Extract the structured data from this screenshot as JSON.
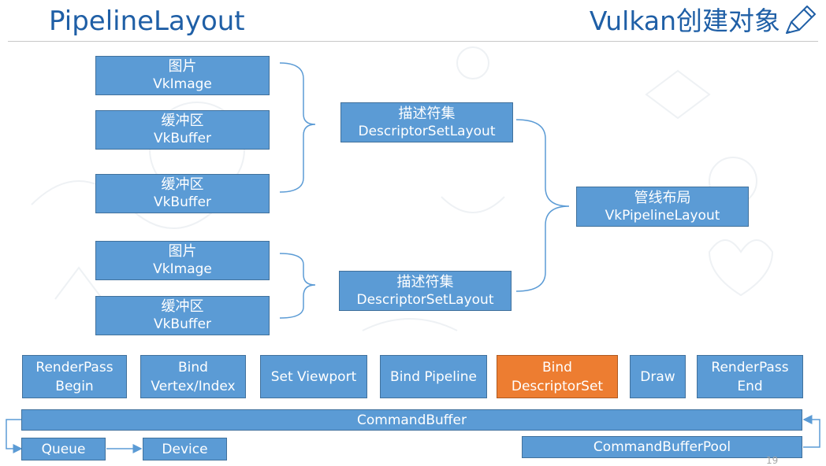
{
  "title": "PipelineLayout",
  "subtitle": "Vulkan创建对象",
  "icons": {
    "pencil": "pencil-icon",
    "background": "doodle-background"
  },
  "colors": {
    "accent": "#5b9bd5",
    "highlight": "#ed7d31",
    "title": "#1f5fa6",
    "connector": "#5b9bd5"
  },
  "resources": [
    {
      "zh": "图片",
      "en": "VkImage"
    },
    {
      "zh": "缓冲区",
      "en": "VkBuffer"
    },
    {
      "zh": "缓冲区",
      "en": "VkBuffer"
    },
    {
      "zh": "图片",
      "en": "VkImage"
    },
    {
      "zh": "缓冲区",
      "en": "VkBuffer"
    }
  ],
  "descriptor_set_layouts": [
    {
      "zh": "描述符集",
      "en": "DescriptorSetLayout"
    },
    {
      "zh": "描述符集",
      "en": "DescriptorSetLayout"
    }
  ],
  "pipeline_layout": {
    "zh": "管线布局",
    "en": "VkPipelineLayout"
  },
  "commands": [
    {
      "line1": "RenderPass",
      "line2": "Begin",
      "highlight": false
    },
    {
      "line1": "Bind",
      "line2": "Vertex/Index",
      "highlight": false
    },
    {
      "line1": "Set Viewport",
      "line2": "",
      "highlight": false
    },
    {
      "line1": "Bind Pipeline",
      "line2": "",
      "highlight": false
    },
    {
      "line1": "Bind",
      "line2": "DescriptorSet",
      "highlight": true
    },
    {
      "line1": "Draw",
      "line2": "",
      "highlight": false
    },
    {
      "line1": "RenderPass",
      "line2": "End",
      "highlight": false
    }
  ],
  "command_buffer": "CommandBuffer",
  "queue": "Queue",
  "device": "Device",
  "command_buffer_pool": "CommandBufferPool",
  "page_number": "19"
}
